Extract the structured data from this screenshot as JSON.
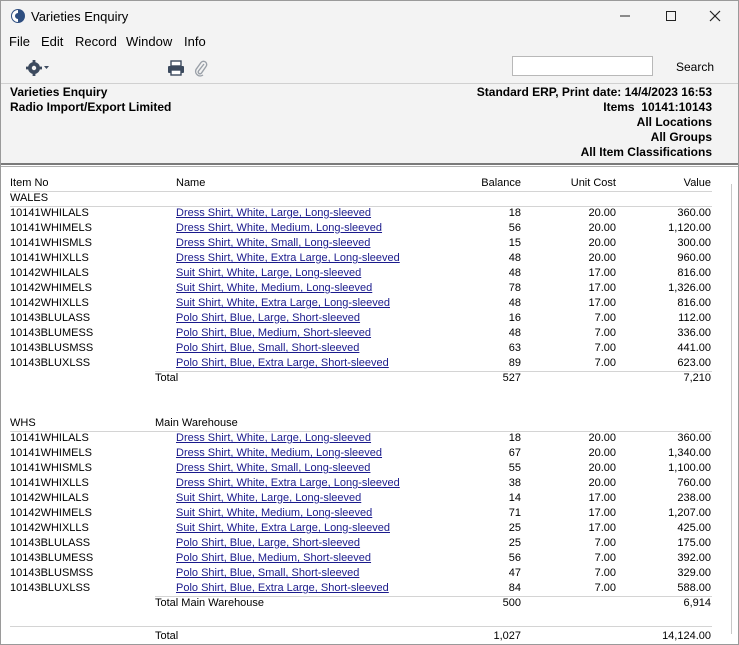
{
  "window": {
    "title": "Varieties Enquiry"
  },
  "menu": [
    "File",
    "Edit",
    "Record",
    "Window",
    "Info"
  ],
  "toolbar": {
    "search_label": "Search",
    "search_value": ""
  },
  "header": {
    "left": [
      "Varieties Enquiry",
      "Radio Import/Export Limited"
    ],
    "right": [
      "Standard ERP, Print date: 14/4/2023 16:53",
      "Items  10141:10143",
      "All Locations",
      "All Groups",
      "All Item Classifications"
    ]
  },
  "columns": {
    "item_no": "Item No",
    "name": "Name",
    "balance": "Balance",
    "unit_cost": "Unit Cost",
    "value": "Value"
  },
  "sections": [
    {
      "code": "WALES",
      "name": "",
      "rows": [
        {
          "item": "10141WHILALS",
          "name": "Dress Shirt, White, Large, Long-sleeved",
          "balance": "18",
          "unit_cost": "20.00",
          "value": "360.00"
        },
        {
          "item": "10141WHIMELS",
          "name": "Dress Shirt, White, Medium, Long-sleeved",
          "balance": "56",
          "unit_cost": "20.00",
          "value": "1,120.00"
        },
        {
          "item": "10141WHISMLS",
          "name": "Dress Shirt, White, Small, Long-sleeved",
          "balance": "15",
          "unit_cost": "20.00",
          "value": "300.00"
        },
        {
          "item": "10141WHIXLLS",
          "name": "Dress Shirt, White, Extra Large, Long-sleeved",
          "balance": "48",
          "unit_cost": "20.00",
          "value": "960.00"
        },
        {
          "item": "10142WHILALS",
          "name": "Suit Shirt, White, Large, Long-sleeved",
          "balance": "48",
          "unit_cost": "17.00",
          "value": "816.00"
        },
        {
          "item": "10142WHIMELS",
          "name": "Suit Shirt, White, Medium, Long-sleeved",
          "balance": "78",
          "unit_cost": "17.00",
          "value": "1,326.00"
        },
        {
          "item": "10142WHIXLLS",
          "name": "Suit Shirt, White, Extra Large, Long-sleeved",
          "balance": "48",
          "unit_cost": "17.00",
          "value": "816.00"
        },
        {
          "item": "10143BLULASS",
          "name": "Polo Shirt, Blue, Large, Short-sleeved",
          "balance": "16",
          "unit_cost": "7.00",
          "value": "112.00"
        },
        {
          "item": "10143BLUMESS",
          "name": "Polo Shirt, Blue, Medium, Short-sleeved",
          "balance": "48",
          "unit_cost": "7.00",
          "value": "336.00"
        },
        {
          "item": "10143BLUSMSS",
          "name": "Polo Shirt, Blue, Small, Short-sleeved",
          "balance": "63",
          "unit_cost": "7.00",
          "value": "441.00"
        },
        {
          "item": "10143BLUXLSS",
          "name": "Polo Shirt, Blue, Extra Large, Short-sleeved",
          "balance": "89",
          "unit_cost": "7.00",
          "value": "623.00"
        }
      ],
      "total_label": "Total",
      "total_balance": "527",
      "total_value": "7,210"
    },
    {
      "code": "WHS",
      "name": "Main Warehouse",
      "rows": [
        {
          "item": "10141WHILALS",
          "name": "Dress Shirt, White, Large, Long-sleeved",
          "balance": "18",
          "unit_cost": "20.00",
          "value": "360.00"
        },
        {
          "item": "10141WHIMELS",
          "name": "Dress Shirt, White, Medium, Long-sleeved",
          "balance": "67",
          "unit_cost": "20.00",
          "value": "1,340.00"
        },
        {
          "item": "10141WHISMLS",
          "name": "Dress Shirt, White, Small, Long-sleeved",
          "balance": "55",
          "unit_cost": "20.00",
          "value": "1,100.00"
        },
        {
          "item": "10141WHIXLLS",
          "name": "Dress Shirt, White, Extra Large, Long-sleeved",
          "balance": "38",
          "unit_cost": "20.00",
          "value": "760.00"
        },
        {
          "item": "10142WHILALS",
          "name": "Suit Shirt, White, Large, Long-sleeved",
          "balance": "14",
          "unit_cost": "17.00",
          "value": "238.00"
        },
        {
          "item": "10142WHIMELS",
          "name": "Suit Shirt, White, Medium, Long-sleeved",
          "balance": "71",
          "unit_cost": "17.00",
          "value": "1,207.00"
        },
        {
          "item": "10142WHIXLLS",
          "name": "Suit Shirt, White, Extra Large, Long-sleeved",
          "balance": "25",
          "unit_cost": "17.00",
          "value": "425.00"
        },
        {
          "item": "10143BLULASS",
          "name": "Polo Shirt, Blue, Large, Short-sleeved",
          "balance": "25",
          "unit_cost": "7.00",
          "value": "175.00"
        },
        {
          "item": "10143BLUMESS",
          "name": "Polo Shirt, Blue, Medium, Short-sleeved",
          "balance": "56",
          "unit_cost": "7.00",
          "value": "392.00"
        },
        {
          "item": "10143BLUSMSS",
          "name": "Polo Shirt, Blue, Small, Short-sleeved",
          "balance": "47",
          "unit_cost": "7.00",
          "value": "329.00"
        },
        {
          "item": "10143BLUXLSS",
          "name": "Polo Shirt, Blue, Extra Large, Short-sleeved",
          "balance": "84",
          "unit_cost": "7.00",
          "value": "588.00"
        }
      ],
      "total_label": "Total Main Warehouse",
      "total_balance": "500",
      "total_value": "6,914"
    }
  ],
  "grand_total": {
    "label": "Total",
    "balance": "1,027",
    "value": "14,124.00"
  }
}
